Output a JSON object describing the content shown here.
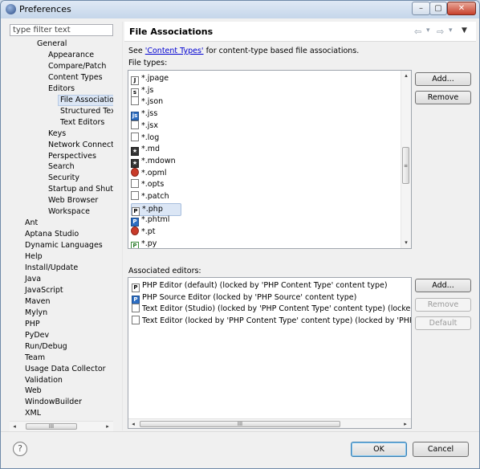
{
  "window": {
    "title": "Preferences",
    "controls": [
      "–",
      "▢",
      "✕"
    ]
  },
  "filter": {
    "placeholder": "type filter text",
    "value": "type filter text"
  },
  "tree": {
    "items": [
      {
        "label": "General",
        "level": 1
      },
      {
        "label": "Appearance",
        "level": 2
      },
      {
        "label": "Compare/Patch",
        "level": 2
      },
      {
        "label": "Content Types",
        "level": 2
      },
      {
        "label": "Editors",
        "level": 2
      },
      {
        "label": "File Associations",
        "level": 3,
        "selected": true
      },
      {
        "label": "Structured Text Edit",
        "level": 3
      },
      {
        "label": "Text Editors",
        "level": 3
      },
      {
        "label": "Keys",
        "level": 2
      },
      {
        "label": "Network Connections",
        "level": 2
      },
      {
        "label": "Perspectives",
        "level": 2
      },
      {
        "label": "Search",
        "level": 2
      },
      {
        "label": "Security",
        "level": 2
      },
      {
        "label": "Startup and Shutdown",
        "level": 2
      },
      {
        "label": "Web Browser",
        "level": 2
      },
      {
        "label": "Workspace",
        "level": 2
      },
      {
        "label": "Ant",
        "level": 0
      },
      {
        "label": "Aptana Studio",
        "level": 0
      },
      {
        "label": "Dynamic Languages",
        "level": 0
      },
      {
        "label": "Help",
        "level": 0
      },
      {
        "label": "Install/Update",
        "level": 0
      },
      {
        "label": "Java",
        "level": 0
      },
      {
        "label": "JavaScript",
        "level": 0
      },
      {
        "label": "Maven",
        "level": 0
      },
      {
        "label": "Mylyn",
        "level": 0
      },
      {
        "label": "PHP",
        "level": 0
      },
      {
        "label": "PyDev",
        "level": 0
      },
      {
        "label": "Run/Debug",
        "level": 0
      },
      {
        "label": "Team",
        "level": 0
      },
      {
        "label": "Usage Data Collector",
        "level": 0
      },
      {
        "label": "Validation",
        "level": 0
      },
      {
        "label": "Web",
        "level": 0
      },
      {
        "label": "WindowBuilder",
        "level": 0
      },
      {
        "label": "XML",
        "level": 0
      }
    ],
    "scroll_left": "◂",
    "scroll_right": "▸",
    "scroll_thumb": "III"
  },
  "page": {
    "title": "File Associations",
    "see_prefix": "See ",
    "see_link": "'Content Types'",
    "see_suffix": " for content-type based file associations.",
    "file_types_label": "File types:",
    "associated_label": "Associated editors:"
  },
  "file_types": [
    {
      "name": "*.jpage",
      "icon": "J"
    },
    {
      "name": "*.js",
      "icon": "js"
    },
    {
      "name": "*.json",
      "icon": "doc"
    },
    {
      "name": "*.jss",
      "icon": "jss"
    },
    {
      "name": "*.jsx",
      "icon": "doc"
    },
    {
      "name": "*.log",
      "icon": "doc"
    },
    {
      "name": "*.md",
      "icon": "md"
    },
    {
      "name": "*.mdown",
      "icon": "md"
    },
    {
      "name": "*.opml",
      "icon": "opml"
    },
    {
      "name": "*.opts",
      "icon": "doc"
    },
    {
      "name": "*.patch",
      "icon": "patch"
    },
    {
      "name": "*.php",
      "icon": "php",
      "selected": true
    },
    {
      "name": "*.phtml",
      "icon": "phtml"
    },
    {
      "name": "*.pt",
      "icon": "pt"
    },
    {
      "name": "*.py",
      "icon": "py"
    }
  ],
  "associated_editors": [
    {
      "name": "PHP Editor (default) (locked by 'PHP Content Type' content type)",
      "icon": "php"
    },
    {
      "name": "PHP Source Editor (locked by 'PHP Source' content type)",
      "icon": "phpsrc"
    },
    {
      "name": "Text Editor (Studio) (locked by 'PHP Content Type' content type) (locked by 'PHP",
      "icon": "doc"
    },
    {
      "name": "Text Editor (locked by 'PHP Content Type' content type) (locked by 'PHP Source'",
      "icon": "doc"
    }
  ],
  "buttons": {
    "add_file": "Add...",
    "remove_file": "Remove",
    "add_editor": "Add...",
    "remove_editor": "Remove",
    "default_editor": "Default",
    "ok": "OK",
    "cancel": "Cancel",
    "help": "?"
  },
  "editors_scroll": {
    "left": "◂",
    "right": "▸",
    "thumb": "III"
  },
  "nav_icons": {
    "back": "⇦",
    "back_menu": "▾",
    "forward": "⇨",
    "forward_menu": "▾",
    "view_menu": "▼"
  }
}
